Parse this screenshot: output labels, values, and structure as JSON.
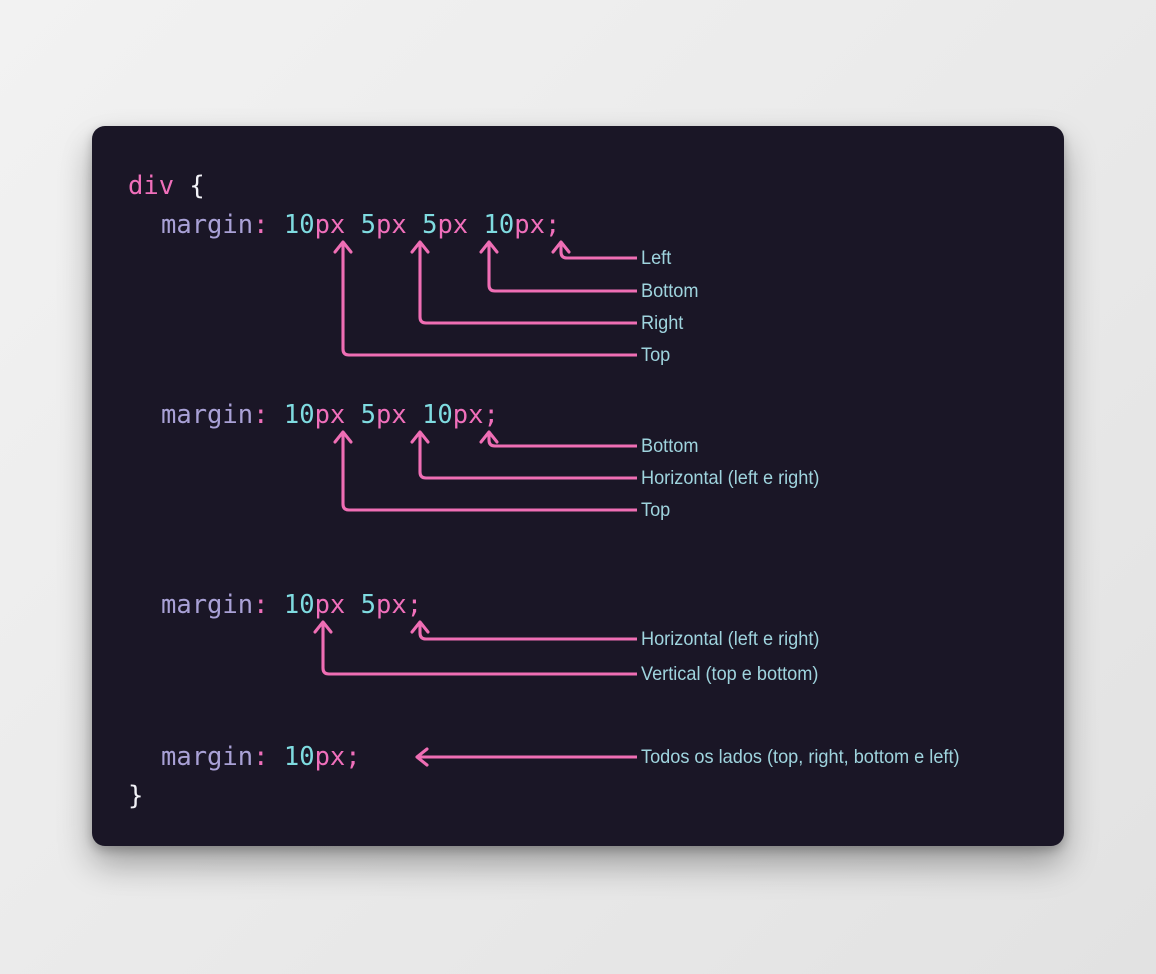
{
  "card": {
    "background_color": "#1a1626",
    "accent_color": "#ef6eb4",
    "label_color": "#9fd4de"
  },
  "code": {
    "selector": "div",
    "open_brace": "{",
    "close_brace": "}",
    "property": "margin",
    "colon": ":",
    "semicolon": ";",
    "declarations": [
      {
        "id": "four-value",
        "values": [
          {
            "number": "10",
            "unit": "px"
          },
          {
            "number": "5",
            "unit": "px"
          },
          {
            "number": "5",
            "unit": "px"
          },
          {
            "number": "10",
            "unit": "px"
          }
        ],
        "annotations": [
          {
            "label": "Left"
          },
          {
            "label": "Bottom"
          },
          {
            "label": "Right"
          },
          {
            "label": "Top"
          }
        ]
      },
      {
        "id": "three-value",
        "values": [
          {
            "number": "10",
            "unit": "px"
          },
          {
            "number": "5",
            "unit": "px"
          },
          {
            "number": "10",
            "unit": "px"
          }
        ],
        "annotations": [
          {
            "label": "Bottom"
          },
          {
            "label": "Horizontal (left e right)"
          },
          {
            "label": "Top"
          }
        ]
      },
      {
        "id": "two-value",
        "values": [
          {
            "number": "10",
            "unit": "px"
          },
          {
            "number": "5",
            "unit": "px"
          }
        ],
        "annotations": [
          {
            "label": "Horizontal (left e right)"
          },
          {
            "label": "Vertical (top e bottom)"
          }
        ]
      },
      {
        "id": "one-value",
        "values": [
          {
            "number": "10",
            "unit": "px"
          }
        ],
        "annotations": [
          {
            "label": "Todos os lados (top, right, bottom e left)"
          }
        ]
      }
    ]
  }
}
